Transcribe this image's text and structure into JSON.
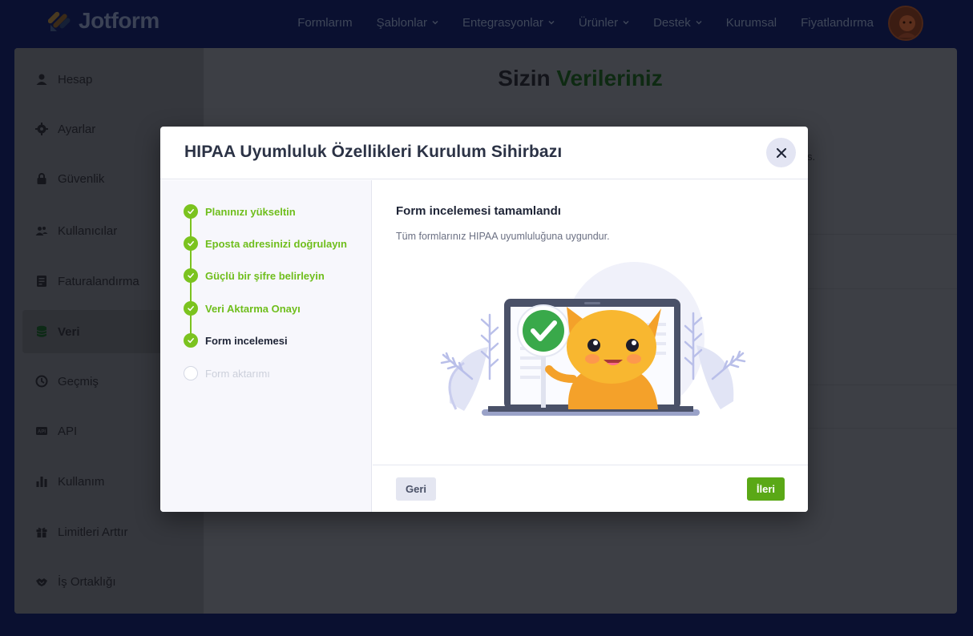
{
  "header": {
    "logo_text": "Jotform",
    "nav": [
      {
        "label": "Formlarım",
        "has_dropdown": false
      },
      {
        "label": "Şablonlar",
        "has_dropdown": true
      },
      {
        "label": "Entegrasyonlar",
        "has_dropdown": true
      },
      {
        "label": "Ürünler",
        "has_dropdown": true
      },
      {
        "label": "Destek",
        "has_dropdown": true
      },
      {
        "label": "Kurumsal",
        "has_dropdown": false
      },
      {
        "label": "Fiyatlandırma",
        "has_dropdown": false
      }
    ]
  },
  "sidebar": {
    "items": [
      {
        "label": "Hesap",
        "icon": "user-icon"
      },
      {
        "label": "Ayarlar",
        "icon": "gear-icon"
      },
      {
        "label": "Güvenlik",
        "icon": "lock-icon"
      },
      {
        "label": "Kullanıcılar",
        "icon": "users-icon"
      },
      {
        "label": "Faturalandırma",
        "icon": "billing-icon"
      },
      {
        "label": "Veri",
        "icon": "database-icon",
        "active": true
      },
      {
        "label": "Geçmiş",
        "icon": "history-icon"
      },
      {
        "label": "API",
        "icon": "api-icon"
      },
      {
        "label": "Kullanım",
        "icon": "bar-chart-icon"
      },
      {
        "label": "Limitleri Arttır",
        "icon": "gift-icon"
      },
      {
        "label": "İş Ortaklığı",
        "icon": "handshake-icon"
      }
    ]
  },
  "main": {
    "title_prefix": "Sizin",
    "title_highlight": "Verileriniz",
    "ghost_text": "s."
  },
  "modal": {
    "title": "HIPAA Uyumluluk Özellikleri Kurulum Sihirbazı",
    "steps": [
      {
        "label": "Planınızı yükseltin",
        "state": "done"
      },
      {
        "label": "Eposta adresinizi doğrulayın",
        "state": "done"
      },
      {
        "label": "Güçlü bir şifre belirleyin",
        "state": "done"
      },
      {
        "label": "Veri Aktarma Onayı",
        "state": "done"
      },
      {
        "label": "Form incelemesi",
        "state": "current"
      },
      {
        "label": "Form aktarımı",
        "state": "pending"
      }
    ],
    "content_title": "Form incelemesi tamamlandı",
    "content_desc": "Tüm formlarınız HIPAA uyumluluğuna uygundur.",
    "back_label": "Geri",
    "next_label": "İleri"
  },
  "colors": {
    "brand_green": "#7bc31f",
    "next_button": "#5aa816",
    "modal_title": "#2b3245",
    "page_bg": "#0a1030"
  }
}
